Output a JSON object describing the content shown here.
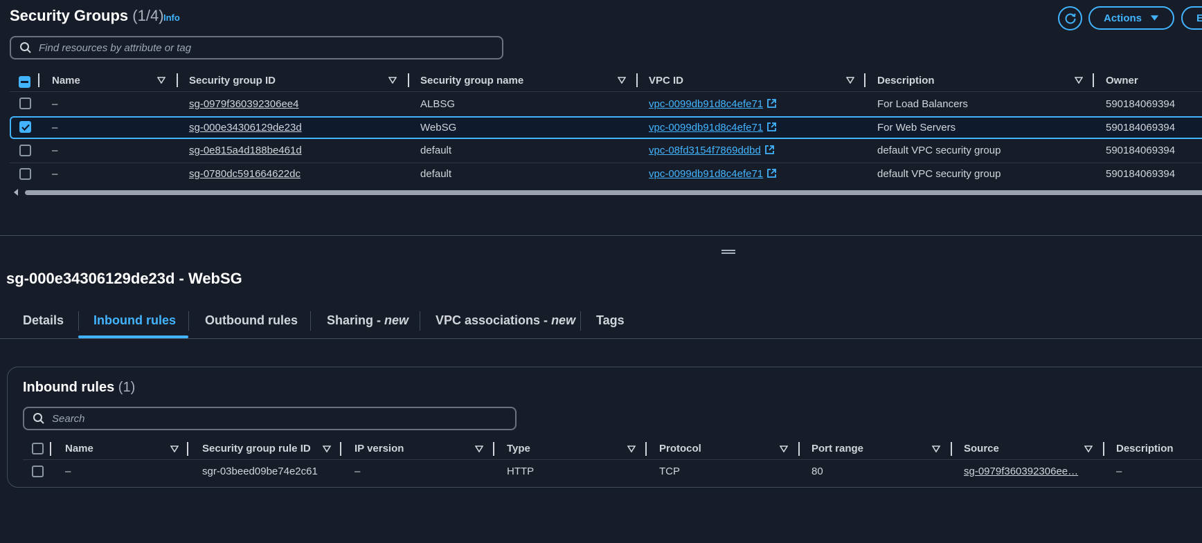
{
  "header": {
    "title": "Security Groups",
    "count": "(1/4)",
    "info_label": "Info",
    "actions_label": "Actions",
    "next_button_label": "E",
    "search_placeholder": "Find resources by attribute or tag"
  },
  "sg_table": {
    "columns": [
      "Name",
      "Security group ID",
      "Security group name",
      "VPC ID",
      "Description",
      "Owner"
    ],
    "rows": [
      {
        "name": "–",
        "id": "sg-0979f360392306ee4",
        "group_name": "ALBSG",
        "vpc_id": "vpc-0099db91d8c4efe71",
        "description": "For Load Balancers",
        "owner": "590184069394",
        "selected": false
      },
      {
        "name": "–",
        "id": "sg-000e34306129de23d",
        "group_name": "WebSG",
        "vpc_id": "vpc-0099db91d8c4efe71",
        "description": "For Web Servers",
        "owner": "590184069394",
        "selected": true
      },
      {
        "name": "–",
        "id": "sg-0e815a4d188be461d",
        "group_name": "default",
        "vpc_id": "vpc-08fd3154f7869ddbd",
        "description": "default VPC security group",
        "owner": "590184069394",
        "selected": false
      },
      {
        "name": "–",
        "id": "sg-0780dc591664622dc",
        "group_name": "default",
        "vpc_id": "vpc-0099db91d8c4efe71",
        "description": "default VPC security group",
        "owner": "590184069394",
        "selected": false
      }
    ]
  },
  "detail": {
    "title": "sg-000e34306129de23d - WebSG",
    "tabs": [
      {
        "label": "Details",
        "suffix": ""
      },
      {
        "label": "Inbound rules",
        "suffix": ""
      },
      {
        "label": "Outbound rules",
        "suffix": ""
      },
      {
        "label": "Sharing - ",
        "suffix": "new"
      },
      {
        "label": "VPC associations - ",
        "suffix": "new"
      },
      {
        "label": "Tags",
        "suffix": ""
      }
    ],
    "active_tab": "Inbound rules"
  },
  "inbound": {
    "title": "Inbound rules",
    "count": "(1)",
    "search_placeholder": "Search",
    "columns": [
      "Name",
      "Security group rule ID",
      "IP version",
      "Type",
      "Protocol",
      "Port range",
      "Source",
      "Description"
    ],
    "rows": [
      {
        "name": "–",
        "rule_id": "sgr-03beed09be74e2c61",
        "ip_version": "–",
        "type": "HTTP",
        "protocol": "TCP",
        "port_range": "80",
        "source": "sg-0979f360392306ee…",
        "description": "–"
      }
    ]
  },
  "colors": {
    "accent": "#42b4ff",
    "background": "#161d28",
    "selected_row": "#0f1b2d"
  }
}
